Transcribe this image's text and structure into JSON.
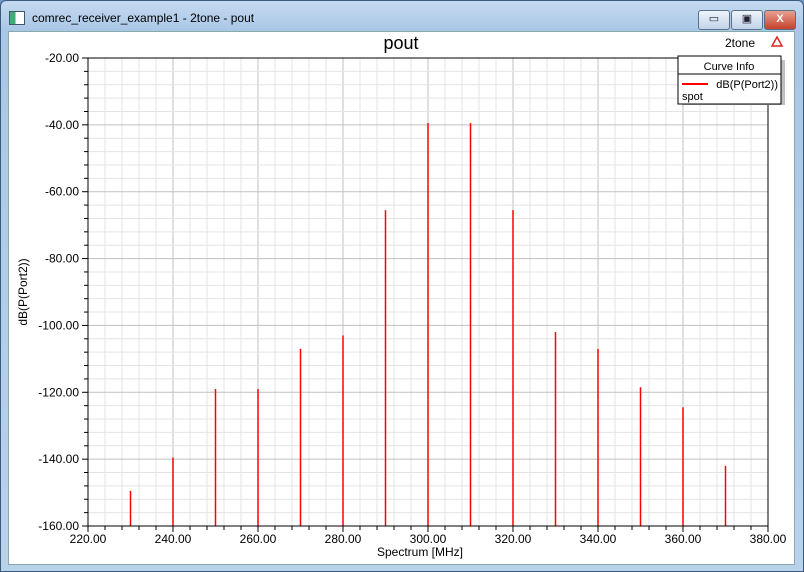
{
  "window": {
    "title": "comrec_receiver_example1 - 2tone - pout",
    "buttons": {
      "minimize": "▭",
      "maximize": "▣",
      "close": "X"
    }
  },
  "plot": {
    "corner_label": "2tone",
    "corner_icon": "ansoft-logo-icon"
  },
  "legend": {
    "title": "Curve Info",
    "entries": [
      {
        "name": "dB(P(Port2))",
        "sub": "spot",
        "color": "#ff0000"
      }
    ]
  },
  "chart_data": {
    "type": "bar",
    "title": "pout",
    "xlabel": "Spectrum [MHz]",
    "ylabel": "dB(P(Port2))",
    "xlim": [
      220,
      380
    ],
    "ylim": [
      -160,
      -20
    ],
    "xticks": [
      "220.00",
      "240.00",
      "260.00",
      "280.00",
      "300.00",
      "320.00",
      "340.00",
      "360.00",
      "380.00"
    ],
    "yticks": [
      "-20.00",
      "-40.00",
      "-60.00",
      "-80.00",
      "-100.00",
      "-120.00",
      "-140.00",
      "-160.00"
    ],
    "grid": true,
    "legend_position": "top-right",
    "series": [
      {
        "name": "dB(P(Port2))",
        "color": "#ff0000",
        "x": [
          230,
          240,
          250,
          260,
          270,
          280,
          290,
          300,
          310,
          320,
          330,
          340,
          350,
          360,
          370
        ],
        "values": [
          -149.5,
          -139.5,
          -119,
          -119,
          -107,
          -103,
          -65.5,
          -39.5,
          -39.5,
          -65.5,
          -102,
          -107,
          -118.5,
          -124.5,
          -142
        ]
      }
    ]
  }
}
